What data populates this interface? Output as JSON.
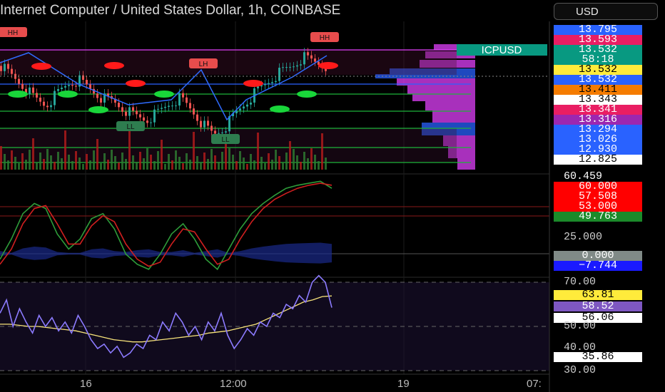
{
  "header": {
    "title": "Internet Computer / United States Dollar, 1h, COINBASE",
    "currency": "USD"
  },
  "chart_data": {
    "type": "line",
    "main_pane": {
      "symbol_label": "ICPUSD",
      "pattern_labels": [
        "HH",
        "HH",
        "LH",
        "LL",
        "LL"
      ],
      "axis_labels": [
        {
          "text": "13.795",
          "bg": "#2962ff",
          "fg": "#ffffff"
        },
        {
          "text": "13.593",
          "bg": "#e91e63",
          "fg": "#ffffff"
        },
        {
          "text": "13.532",
          "bg": "#089981",
          "fg": "#ffffff"
        },
        {
          "text": "58:18",
          "bg": "#089981",
          "fg": "#ffffff"
        },
        {
          "text": "13.532",
          "bg": "#ffeb3b",
          "fg": "#000000"
        },
        {
          "text": "13.532",
          "bg": "#2962ff",
          "fg": "#ffffff"
        },
        {
          "text": "13.411",
          "bg": "#f57c00",
          "fg": "#000000"
        },
        {
          "text": "13.343",
          "bg": "#ffffff",
          "fg": "#000000"
        },
        {
          "text": "13.341",
          "bg": "#e91e63",
          "fg": "#ffffff"
        },
        {
          "text": "13.316",
          "bg": "#9c27b0",
          "fg": "#ffffff"
        },
        {
          "text": "13.294",
          "bg": "#2962ff",
          "fg": "#ffffff"
        },
        {
          "text": "13.026",
          "bg": "#2962ff",
          "fg": "#ffffff"
        },
        {
          "text": "12.930",
          "bg": "#2962ff",
          "fg": "#ffffff"
        },
        {
          "text": "12.825",
          "bg": "#ffffff",
          "fg": "#000000"
        }
      ],
      "series": [
        {
          "values": [
            13.52,
            13.45,
            13.38,
            13.3,
            13.25,
            13.33,
            13.4,
            13.42,
            13.36,
            13.3,
            13.28,
            13.22,
            13.18,
            13.15,
            13.2,
            13.26,
            13.3,
            13.22,
            13.12,
            13.05,
            13.1,
            13.2,
            13.28,
            13.36,
            13.42,
            13.48,
            13.52,
            13.58,
            13.55,
            13.52
          ]
        }
      ]
    },
    "stoch_pane": {
      "axis_labels": [
        {
          "text": "60.459",
          "bg": "",
          "fg": "#ffffff"
        },
        {
          "text": "60.000",
          "bg": "#ff0000",
          "fg": "#ffffff"
        },
        {
          "text": "57.508",
          "bg": "#ff0000",
          "fg": "#ffffff"
        },
        {
          "text": "53.000",
          "bg": "#ff0000",
          "fg": "#ffffff"
        },
        {
          "text": "49.763",
          "bg": "#1b8a2a",
          "fg": "#ffffff"
        },
        {
          "text": "25.000",
          "bg": "",
          "fg": "#cfcfcf"
        },
        {
          "text": "0.000",
          "bg": "#808a87",
          "fg": "#ffffff"
        },
        {
          "text": "−7.744",
          "bg": "#1a1aff",
          "fg": "#ffffff"
        }
      ],
      "series": [
        {
          "name": "k",
          "color": "#2e9d3a",
          "values": [
            -15,
            5,
            30,
            40,
            35,
            10,
            -5,
            5,
            25,
            30,
            15,
            -10,
            -20,
            -25,
            -10,
            10,
            20,
            5,
            -15,
            -25,
            -5,
            15,
            30,
            40,
            48,
            55,
            58,
            60,
            62,
            55
          ]
        },
        {
          "name": "d",
          "color": "#d01f1f",
          "values": [
            -20,
            -5,
            20,
            35,
            38,
            20,
            0,
            0,
            18,
            28,
            22,
            0,
            -15,
            -22,
            -18,
            0,
            15,
            12,
            -5,
            -20,
            -15,
            5,
            22,
            35,
            44,
            50,
            55,
            58,
            60,
            58
          ]
        }
      ]
    },
    "rsi_pane": {
      "axis_labels": [
        {
          "text": "70.00",
          "bg": "",
          "fg": "#cfcfcf"
        },
        {
          "text": "63.81",
          "bg": "#ffeb3b",
          "fg": "#000000"
        },
        {
          "text": "58.52",
          "bg": "#7e57c2",
          "fg": "#ffffff"
        },
        {
          "text": "56.06",
          "bg": "#ffffff",
          "fg": "#000000"
        },
        {
          "text": "50.00",
          "bg": "",
          "fg": "#cfcfcf"
        },
        {
          "text": "40.00",
          "bg": "",
          "fg": "#cfcfcf"
        },
        {
          "text": "35.86",
          "bg": "#ffffff",
          "fg": "#000000"
        },
        {
          "text": "30.00",
          "bg": "",
          "fg": "#cfcfcf"
        }
      ],
      "ylim": [
        30,
        70
      ],
      "series": [
        {
          "name": "rsi",
          "color": "#8c7bff",
          "values": [
            56,
            62,
            50,
            58,
            52,
            47,
            55,
            50,
            54,
            48,
            52,
            47,
            55,
            50,
            44,
            40,
            42,
            38,
            41,
            36,
            38,
            42,
            40,
            46,
            44,
            52,
            48,
            56,
            52,
            46,
            50,
            44,
            52,
            48,
            56,
            46,
            40,
            44,
            49,
            46,
            52,
            50,
            56,
            54,
            60,
            58,
            64,
            61,
            70,
            73,
            70,
            58.5
          ]
        },
        {
          "name": "rsi_ma",
          "color": "#f7e37a",
          "values": [
            51,
            51,
            50.5,
            50,
            50,
            49.5,
            49,
            48.5,
            48,
            47,
            46,
            45,
            44,
            43.5,
            43,
            43,
            43.5,
            44,
            44.5,
            45,
            45.5,
            46,
            47,
            47.5,
            48,
            49,
            50,
            51,
            53,
            55,
            57,
            59,
            61,
            62,
            63.5,
            63.8
          ]
        }
      ]
    },
    "x_tick_labels": [
      "16",
      "12:00",
      "19",
      "07:"
    ]
  }
}
